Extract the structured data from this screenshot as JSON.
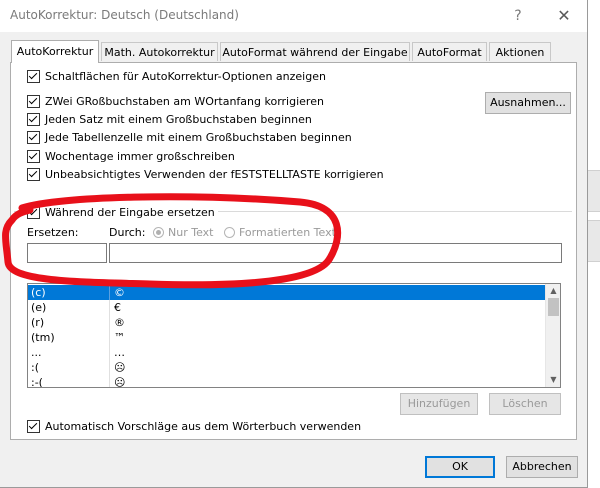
{
  "window": {
    "title": "AutoKorrektur: Deutsch (Deutschland)",
    "help_glyph": "?",
    "close_glyph": "✕"
  },
  "tabs": [
    {
      "label": "AutoKorrektur",
      "active": true
    },
    {
      "label": "Math. Autokorrektur"
    },
    {
      "label": "AutoFormat während der Eingabe"
    },
    {
      "label": "AutoFormat"
    },
    {
      "label": "Aktionen"
    }
  ],
  "options": {
    "show_buttons": "Schaltflächen für AutoKorrektur-Optionen anzeigen",
    "two_caps": "ZWei GRoßbuchstaben am WOrtanfang korrigieren",
    "sentence_cap": "Jeden Satz mit einem Großbuchstaben beginnen",
    "table_cell_cap": "Jede Tabellenzelle mit einem Großbuchstaben beginnen",
    "weekdays_cap": "Wochentage immer großschreiben",
    "caps_lock": "Unbeabsichtigtes Verwenden der fESTSTELLTASTE korrigieren",
    "replace_while_typing": "Während der Eingabe ersetzen",
    "auto_suggestions": "Automatisch Vorschläge aus dem Wörterbuch verwenden"
  },
  "buttons": {
    "exceptions": "Ausnahmen...",
    "add": "Hinzufügen",
    "delete": "Löschen",
    "ok": "OK",
    "cancel": "Abbrechen"
  },
  "replace": {
    "replace_label": "Ersetzen:",
    "with_label": "Durch:",
    "plain_text": "Nur Text",
    "formatted_text": "Formatierten Text",
    "replace_value": "",
    "with_value": ""
  },
  "entries": [
    {
      "from": "(c)",
      "to": "©"
    },
    {
      "from": "(e)",
      "to": "€"
    },
    {
      "from": "(r)",
      "to": "®"
    },
    {
      "from": "(tm)",
      "to": "™"
    },
    {
      "from": "...",
      "to": "…"
    },
    {
      "from": ":(",
      "to": "☹"
    },
    {
      "from": ":-(",
      "to": "☹"
    }
  ],
  "colors": {
    "accent": "#0078d7",
    "annotation": "#e8101a"
  }
}
